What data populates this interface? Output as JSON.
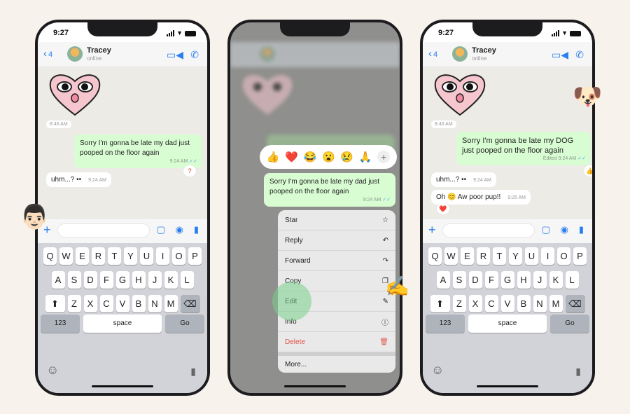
{
  "status": {
    "time": "9:27"
  },
  "header": {
    "back_count": "4",
    "contact_name": "Tracey",
    "contact_status": "online"
  },
  "phone1": {
    "date_stamp": "8:46 AM",
    "outgoing": {
      "text": "Sorry I'm gonna be late my dad just pooped on the floor again",
      "time": "9:24 AM",
      "reaction": "?"
    },
    "incoming": [
      {
        "text": "uhm...? ••",
        "time": "9:24 AM"
      }
    ]
  },
  "phone2": {
    "reactions": [
      "👍",
      "❤️",
      "😂",
      "😮",
      "😢",
      "🙏",
      "+"
    ],
    "message": {
      "text": "Sorry I'm gonna be late my dad just pooped on the floor again",
      "time": "9:24 AM"
    },
    "menu": [
      {
        "label": "Star",
        "icon": "☆"
      },
      {
        "label": "Reply",
        "icon": "↶"
      },
      {
        "label": "Forward",
        "icon": "↷"
      },
      {
        "label": "Copy",
        "icon": "❐"
      },
      {
        "label": "Edit",
        "icon": "✎"
      },
      {
        "label": "Info",
        "icon": "ⓘ"
      },
      {
        "label": "Delete",
        "icon": "🗑"
      },
      {
        "label": "More...",
        "icon": ""
      }
    ]
  },
  "phone3": {
    "date_stamp": "8:46 AM",
    "outgoing": {
      "text": "Sorry I'm gonna be late my DOG just pooped on the floor again",
      "time": "Edited 9:24 AM",
      "reaction": "👍"
    },
    "incoming": [
      {
        "text": "uhm...? ••",
        "time": "9:24 AM"
      },
      {
        "text": "Oh 😊 Aw poor pup!!",
        "time": "9:25 AM",
        "reaction": "❤️"
      }
    ]
  },
  "keyboard": {
    "row1": [
      "Q",
      "W",
      "E",
      "R",
      "T",
      "Y",
      "U",
      "I",
      "O",
      "P"
    ],
    "row2": [
      "A",
      "S",
      "D",
      "F",
      "G",
      "H",
      "J",
      "K",
      "L"
    ],
    "row3": [
      "Z",
      "X",
      "C",
      "V",
      "B",
      "N",
      "M"
    ],
    "num_label": "123",
    "space_label": "space",
    "go_label": "Go",
    "shift": "⬆",
    "backspace": "⌫"
  },
  "decor": {
    "man": "👨🏻",
    "dog": "🐶",
    "hand": "✍️"
  }
}
